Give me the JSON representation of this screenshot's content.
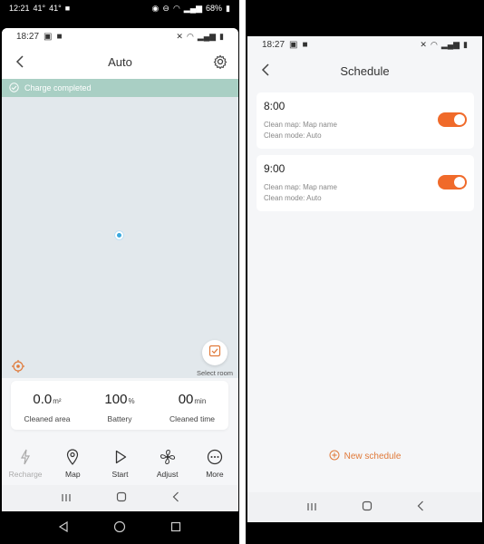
{
  "left": {
    "outer_status": {
      "time": "12:21",
      "temp1": "41°",
      "temp2": "41°",
      "battery": "68%"
    },
    "status_bar": {
      "time": "18:27"
    },
    "header": {
      "title": "Auto"
    },
    "banner": {
      "text": "Charge completed"
    },
    "select_room": {
      "label": "Select room"
    },
    "stats": [
      {
        "value": "0.0",
        "unit": "m²",
        "label": "Cleaned area"
      },
      {
        "value": "100",
        "unit": "%",
        "label": "Battery"
      },
      {
        "value": "00",
        "unit": "min",
        "label": "Cleaned time"
      }
    ],
    "nav": [
      {
        "label": "Recharge",
        "icon": "recharge-icon"
      },
      {
        "label": "Map",
        "icon": "map-pin-icon"
      },
      {
        "label": "Start",
        "icon": "play-icon"
      },
      {
        "label": "Adjust",
        "icon": "fan-icon"
      },
      {
        "label": "More",
        "icon": "more-icon"
      }
    ]
  },
  "right": {
    "status_bar": {
      "time": "18:27"
    },
    "header": {
      "title": "Schedule"
    },
    "schedules": [
      {
        "time": "8:00",
        "map": "Clean map: Map name",
        "mode": "Clean mode: Auto",
        "enabled": true
      },
      {
        "time": "9:00",
        "map": "Clean map: Map name",
        "mode": "Clean mode: Auto",
        "enabled": true
      }
    ],
    "new_schedule": "New schedule"
  },
  "colors": {
    "accent": "#f06a2a",
    "banner": "#a9cfc4",
    "map_bg": "#e2e8ec",
    "robot": "#3aa8de",
    "new_schedule": "#e07a3a"
  }
}
